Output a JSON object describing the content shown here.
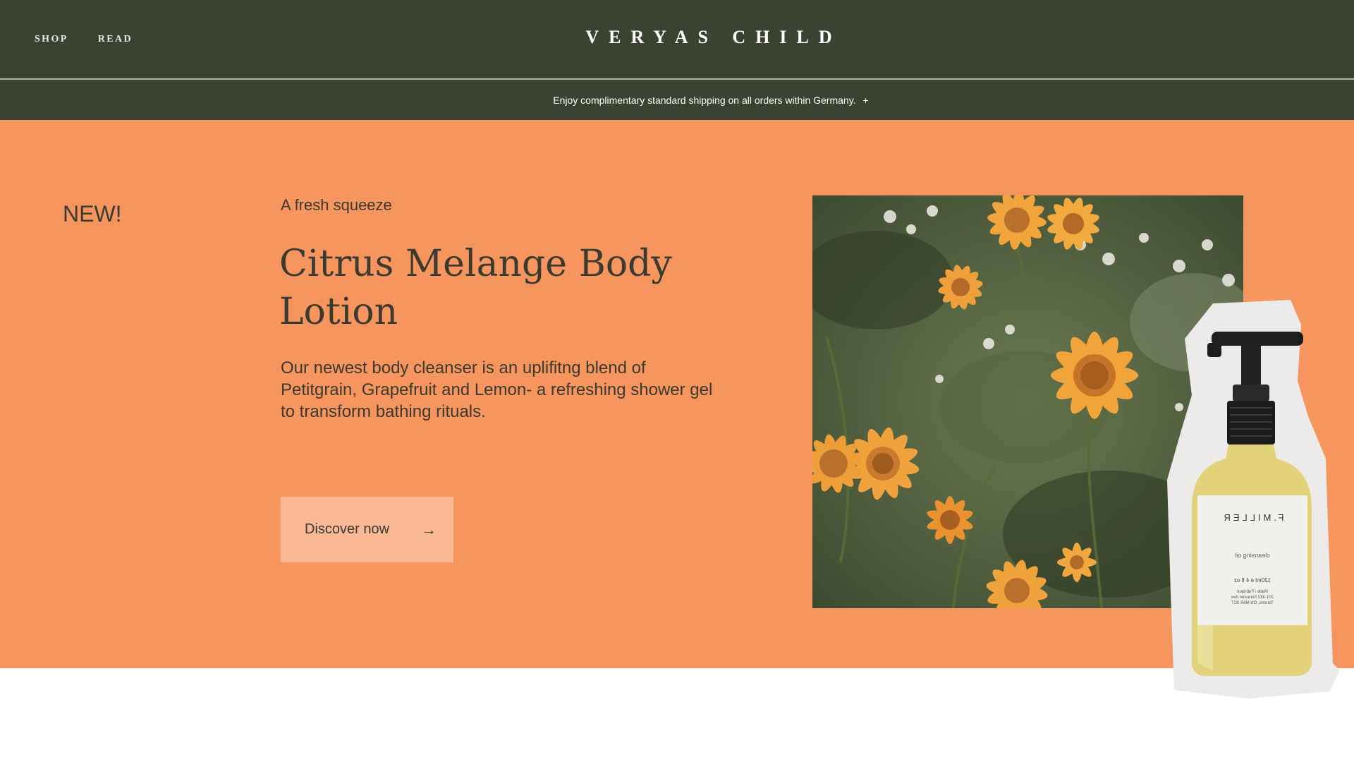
{
  "header": {
    "nav": [
      "SHOP",
      "READ"
    ],
    "brand": "VERYAS CHILD"
  },
  "announcement": {
    "text": "Enjoy complimentary standard shipping on all orders within Germany.",
    "toggle": "+"
  },
  "hero": {
    "badge": "NEW!",
    "eyebrow": "A fresh squeeze",
    "title": "Citrus Melange Body Lotion",
    "description": "Our newest body cleanser is an uplifitng blend of Petitgrain, Grapefruit and Lemon- a refreshing shower gel to transform bathing rituals.",
    "cta_label": "Discover now",
    "cta_icon": "arrow-right-icon"
  },
  "bottle_label": {
    "brand": "F.MILLER",
    "product": "cleansing oil",
    "volume": "120ml e 4 fl oz",
    "details": [
      "Made / Fabriqué",
      "201-363 Sorauren Ave",
      "Toronto, ON M6R 3C7"
    ]
  },
  "colors": {
    "header_bg": "#3c4232",
    "hero_bg": "#f6955d",
    "cta_bg": "#fbb895",
    "text": "#3a3a30"
  }
}
